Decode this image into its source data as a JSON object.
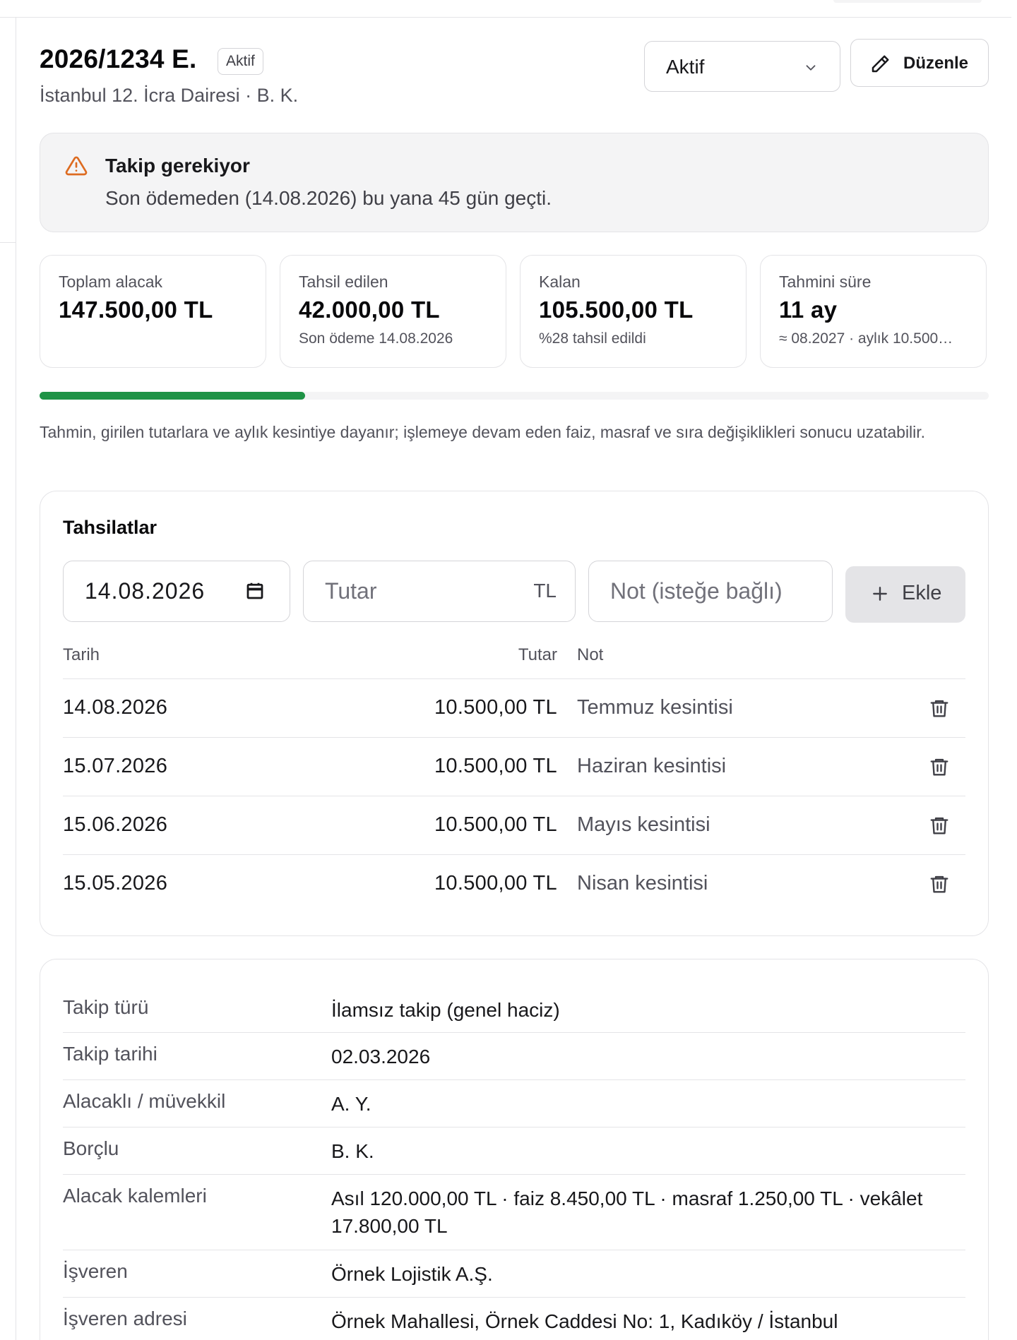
{
  "case": {
    "title": "2026/1234 E.",
    "badge": "Aktif",
    "subtitle": "İstanbul 12. İcra Dairesi · B. K.",
    "status_value": "Aktif",
    "edit_label": "Düzenle"
  },
  "alert": {
    "title": "Takip gerekiyor",
    "text": "Son ödemeden (14.08.2026) bu yana 45 gün geçti.",
    "color": "#dd6b20"
  },
  "stats": [
    {
      "label": "Toplam alacak",
      "value": "147.500,00 TL",
      "sub": ""
    },
    {
      "label": "Tahsil edilen",
      "value": "42.000,00 TL",
      "sub": "Son ödeme 14.08.2026"
    },
    {
      "label": "Kalan",
      "value": "105.500,00 TL",
      "sub": "%28 tahsil edildi"
    },
    {
      "label": "Tahmini süre",
      "value": "11 ay",
      "sub": "≈ 08.2027 · aylık 10.500…"
    }
  ],
  "progress": {
    "percent": 28,
    "color": "#1f9346"
  },
  "estimate_note": "Tahmin, girilen tutarlara ve aylık kesintiye dayanır; işlemeye devam eden faiz, masraf ve sıra değişiklikleri sonucu uzatabilir.",
  "payments": {
    "title": "Tahsilatlar",
    "form": {
      "date_value": "14.08.2026",
      "amount_placeholder": "Tutar",
      "amount_suffix": "TL",
      "note_placeholder": "Not (isteğe bağlı)",
      "add_label": "Ekle"
    },
    "headers": {
      "date": "Tarih",
      "amount": "Tutar",
      "note": "Not"
    },
    "rows": [
      {
        "date": "14.08.2026",
        "amount": "10.500,00 TL",
        "note": "Temmuz kesintisi"
      },
      {
        "date": "15.07.2026",
        "amount": "10.500,00 TL",
        "note": "Haziran kesintisi"
      },
      {
        "date": "15.06.2026",
        "amount": "10.500,00 TL",
        "note": "Mayıs kesintisi"
      },
      {
        "date": "15.05.2026",
        "amount": "10.500,00 TL",
        "note": "Nisan kesintisi"
      }
    ]
  },
  "details": [
    {
      "key": "Takip türü",
      "value": "İlamsız takip (genel haciz)"
    },
    {
      "key": "Takip tarihi",
      "value": "02.03.2026"
    },
    {
      "key": "Alacaklı / müvekkil",
      "value": "A. Y."
    },
    {
      "key": "Borçlu",
      "value": "B. K."
    },
    {
      "key": "Alacak kalemleri",
      "value": "Asıl 120.000,00 TL · faiz 8.450,00 TL · masraf 1.250,00 TL · vekâlet 17.800,00 TL"
    },
    {
      "key": "İşveren",
      "value": "Örnek Lojistik A.Ş."
    },
    {
      "key": "İşveren adresi",
      "value": "Örnek Mahallesi, Örnek Caddesi No: 1, Kadıköy / İstanbul"
    }
  ]
}
